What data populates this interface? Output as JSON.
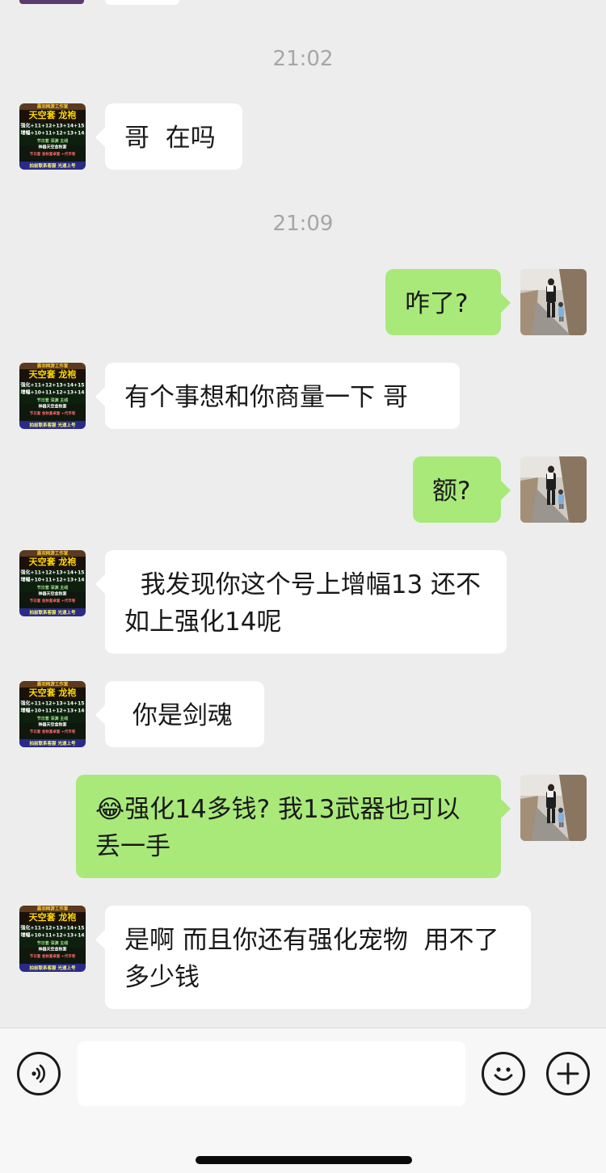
{
  "contact_avatar": {
    "name": "contact-avatar",
    "lines": [
      "嘉羽网游工作室",
      "天空套 龙袍",
      "强化+11+12+13+14+15",
      "增幅+10+11+12+13+14",
      "节日套 深渊 主线",
      "神器天空金秋套",
      "节日套 金秋套卓套 +代币卷",
      "拍前联系客服  光速上号"
    ]
  },
  "self_avatar": {
    "name": "self-avatar"
  },
  "messages": [
    {
      "type": "time",
      "text": "21:02"
    },
    {
      "type": "in",
      "text": "哥  在吗"
    },
    {
      "type": "time",
      "text": "21:09"
    },
    {
      "type": "out",
      "text": "咋了?"
    },
    {
      "type": "in",
      "text": "有个事想和你商量一下 哥"
    },
    {
      "type": "out",
      "text": "额?"
    },
    {
      "type": "in",
      "text": "  我发现你这个号上增幅13 还不如上强化14呢"
    },
    {
      "type": "in",
      "text": " 你是剑魂"
    },
    {
      "type": "out",
      "emoji": "😂",
      "text": "强化14多钱? 我13武器也可以丢一手"
    },
    {
      "type": "in",
      "text": "是啊 而且你还有强化宠物  用不了多少钱"
    }
  ],
  "input": {
    "placeholder": ""
  },
  "colors": {
    "background": "#ededed",
    "incoming": "#ffffff",
    "outgoing": "#a9e97a",
    "time": "#a6a6a6"
  }
}
